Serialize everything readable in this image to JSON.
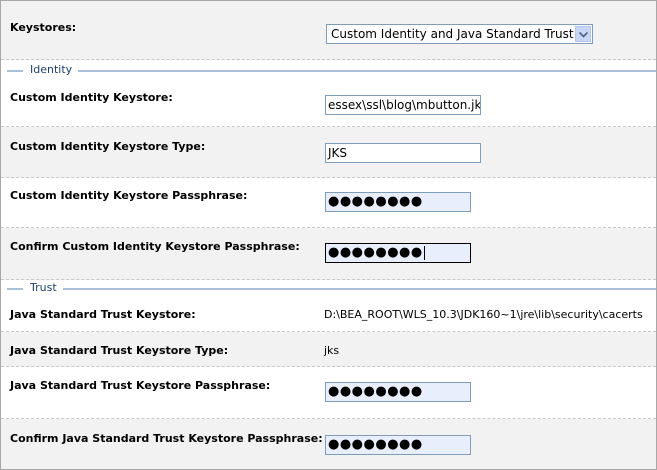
{
  "keystores": {
    "label": "Keystores:",
    "selected": "Custom Identity and Java Standard Trust",
    "dropdown_icon": "chevron-down-icon"
  },
  "identity": {
    "legend": "Identity",
    "keystore_label": "Custom Identity Keystore:",
    "keystore_value": "essex\\ssl\\blog\\mbutton.jks",
    "type_label": "Custom Identity Keystore Type:",
    "type_value": "JKS",
    "passphrase_label": "Custom Identity Keystore Passphrase:",
    "passphrase_value": "●●●●●●●●",
    "confirm_label": "Confirm Custom Identity Keystore Passphrase:",
    "confirm_value": "●●●●●●●●"
  },
  "trust": {
    "legend": "Trust",
    "keystore_label": "Java Standard Trust Keystore:",
    "keystore_value": "D:\\BEA_ROOT\\WLS_10.3\\JDK160~1\\jre\\lib\\security\\cacerts",
    "type_label": "Java Standard Trust Keystore Type:",
    "type_value": "jks",
    "passphrase_label": "Java Standard Trust Keystore Passphrase:",
    "passphrase_value": "●●●●●●●●",
    "confirm_label": "Confirm Java Standard Trust Keystore Passphrase:",
    "confirm_value": "●●●●●●●●"
  },
  "colors": {
    "row_alt": "#f2f2f2",
    "legend_line": "#a9c0db",
    "input_border": "#7f9db9",
    "password_fill": "#e8eefb"
  }
}
